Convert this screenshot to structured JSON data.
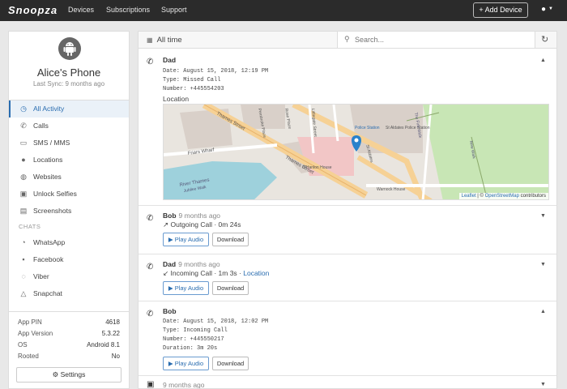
{
  "app": {
    "logo": "Snoopza",
    "nav": [
      "Devices",
      "Subscriptions",
      "Support"
    ],
    "add_device": "+ Add Device"
  },
  "device": {
    "name": "Alice's Phone",
    "last_sync": "Last Sync: 9 months ago"
  },
  "menu": {
    "items": [
      "All Activity",
      "Calls",
      "SMS / MMS",
      "Locations",
      "Websites",
      "Unlock Selfies",
      "Screenshots"
    ],
    "chats_label": "CHATS",
    "chats": [
      "WhatsApp",
      "Facebook",
      "Viber",
      "Snapchat"
    ]
  },
  "info": {
    "rows": [
      {
        "label": "App PIN",
        "value": "4618"
      },
      {
        "label": "App Version",
        "value": "5.3.22"
      },
      {
        "label": "OS",
        "value": "Android 8.1"
      },
      {
        "label": "Rooted",
        "value": "No"
      }
    ],
    "settings": "Settings"
  },
  "filter": {
    "label": "All time",
    "search_placeholder": "Search..."
  },
  "entries": [
    {
      "name": "Dad",
      "details": [
        "Date: August 15, 2018, 12:19 PM",
        "Type: Missed Call",
        "Number: +445554203"
      ],
      "location": "Location"
    },
    {
      "name": "Bob",
      "time": "9 months ago",
      "line": "↗ Outgoing Call · 0m 24s"
    },
    {
      "name": "Dad",
      "time": "9 months ago",
      "line": "↙ Incoming Call · 1m 3s · ",
      "location": "Location"
    },
    {
      "name": "Bob",
      "details": [
        "Date: August 15, 2018, 12:02 PM",
        "Type: Incoming Call",
        "Number: +445550217",
        "Duration: 3m 20s"
      ]
    },
    {
      "time": "9 months ago"
    }
  ],
  "buttons": {
    "play": "▶ Play Audio",
    "download": "Download"
  },
  "map": {
    "labels": [
      "Thames Street",
      "Thames Street",
      "Friars Wharf",
      "River Thames",
      "Jubilee Walk",
      "Pembroke Place",
      "Rose Place",
      "Littlegate Street",
      "St Aldates",
      "O'Hanlon House",
      "St Aldates Police Station",
      "Warnock House",
      "Police Station",
      "The Fink Walk",
      "New Walk"
    ],
    "attribution_leaflet": "Leaflet",
    "attribution_sep": " | © ",
    "attribution_osm": "OpenStreetMap",
    "attribution_tail": " contributors"
  },
  "colors": {
    "accent": "#2a6db0",
    "topbar": "#2b2b2b",
    "map_pin": "#2a81cb",
    "park": "#c8e6b5",
    "road": "#f6d195",
    "river": "#9ed1dc"
  }
}
